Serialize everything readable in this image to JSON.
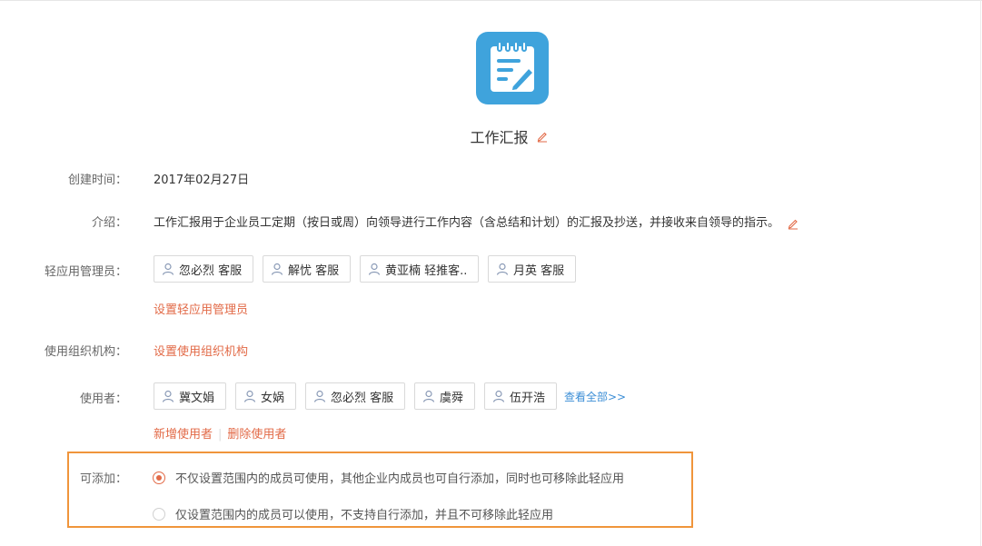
{
  "app": {
    "title": "工作汇报",
    "icon": "notepad-pen-icon",
    "icon_color": "#3fa3dc"
  },
  "fields": {
    "created_label": "创建时间：",
    "created_value": "2017年02月27日",
    "intro_label": "介绍：",
    "intro_value": "工作汇报用于企业员工定期（按日或周）向领导进行工作内容（含总结和计划）的汇报及抄送，并接收来自领导的指示。",
    "admins_label": "轻应用管理员：",
    "admins": [
      "忽必烈 客服",
      "解忧 客服",
      "黄亚楠 轻推客..",
      "月英 客服"
    ],
    "set_admins_link": "设置轻应用管理员",
    "org_label": "使用组织机构：",
    "set_org_link": "设置使用组织机构",
    "users_label": "使用者：",
    "users": [
      "冀文娟",
      "女娲",
      "忽必烈 客服",
      "虞舜",
      "伍开浩"
    ],
    "view_all_link": "查看全部>>",
    "add_user_link": "新增使用者",
    "delete_user_link": "删除使用者",
    "addable_label": "可添加：",
    "addable_options": [
      {
        "text": "不仅设置范围内的成员可使用，其他企业内成员也可自行添加，同时也可移除此轻应用",
        "checked": true
      },
      {
        "text": "仅设置范围内的成员可以使用，不支持自行添加，并且不可移除此轻应用",
        "checked": false
      }
    ]
  },
  "colors": {
    "accent": "#e26a47",
    "link_blue": "#3b8ed6",
    "highlight_border": "#f0953b"
  }
}
